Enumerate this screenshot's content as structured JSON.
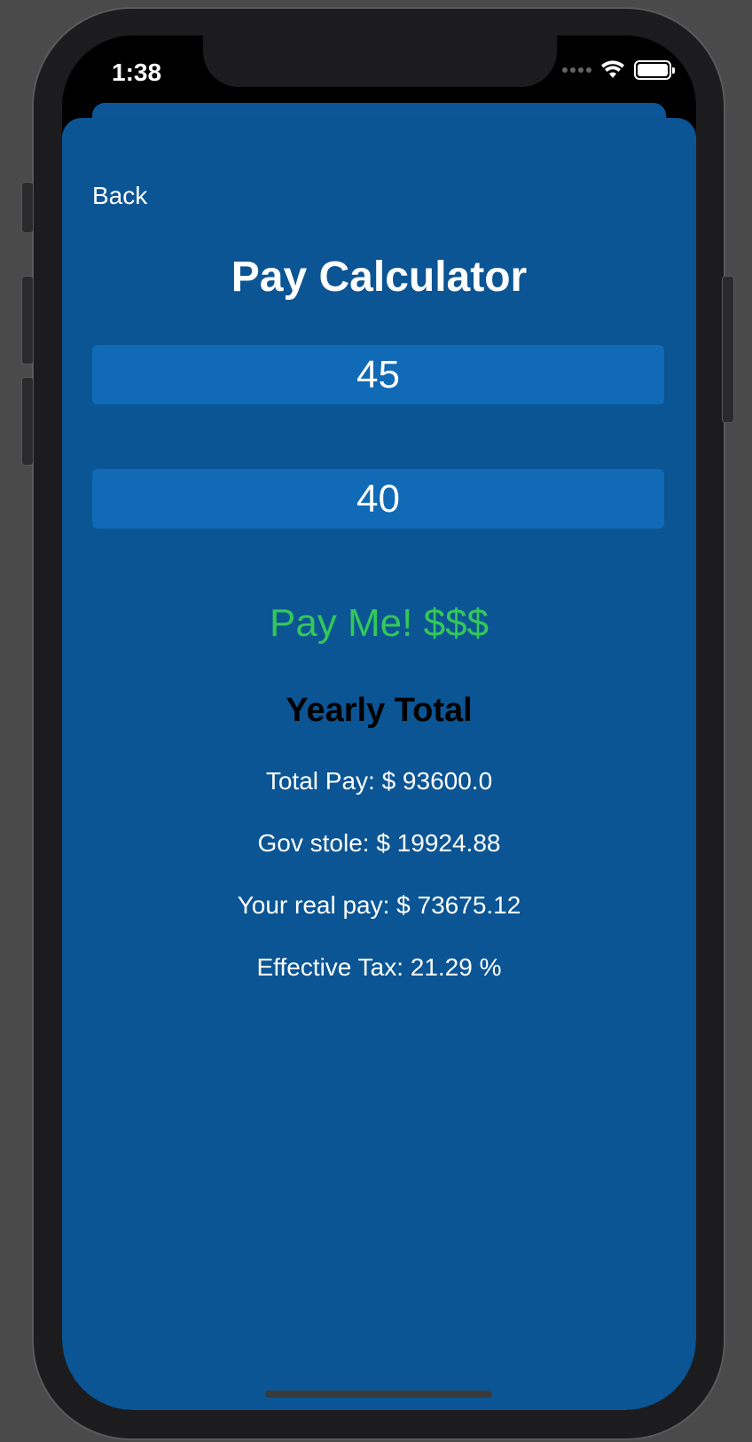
{
  "status_bar": {
    "time": "1:38",
    "icons": [
      "signal-icon",
      "wifi-icon",
      "battery-icon"
    ]
  },
  "nav": {
    "back_label": "Back"
  },
  "page": {
    "title": "Pay Calculator"
  },
  "inputs": {
    "hourly_rate": "45",
    "hours_per_week": "40"
  },
  "actions": {
    "pay_label": "Pay Me! $$$"
  },
  "results": {
    "heading": "Yearly Total",
    "total_pay": "Total Pay: $ 93600.0",
    "gov_stole": "Gov stole: $ 19924.88",
    "real_pay": "Your real pay: $ 73675.12",
    "effective_tax": "Effective Tax: 21.29 %"
  },
  "colors": {
    "sheet_background": "#0b5594",
    "input_background": "#106ab5",
    "pay_button": "#34c759",
    "heading": "#000000"
  }
}
